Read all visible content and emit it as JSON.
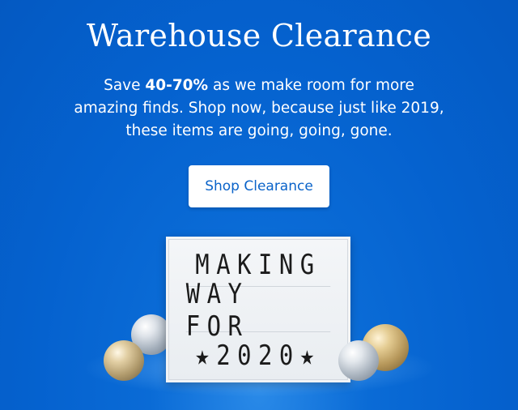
{
  "hero": {
    "title": "Warehouse Clearance",
    "subtitle_pre": "Save ",
    "subtitle_bold": "40-70%",
    "subtitle_post": " as we make room for more amazing finds. Shop now, because just like 2019, these items are going, going, gone.",
    "cta_label": "Shop Clearance"
  },
  "lightbox": {
    "line1": "MAKING",
    "line2": "WAY FOR",
    "line3": "★2020★"
  },
  "colors": {
    "background": "#0562cf",
    "button_text": "#0a63c9"
  }
}
